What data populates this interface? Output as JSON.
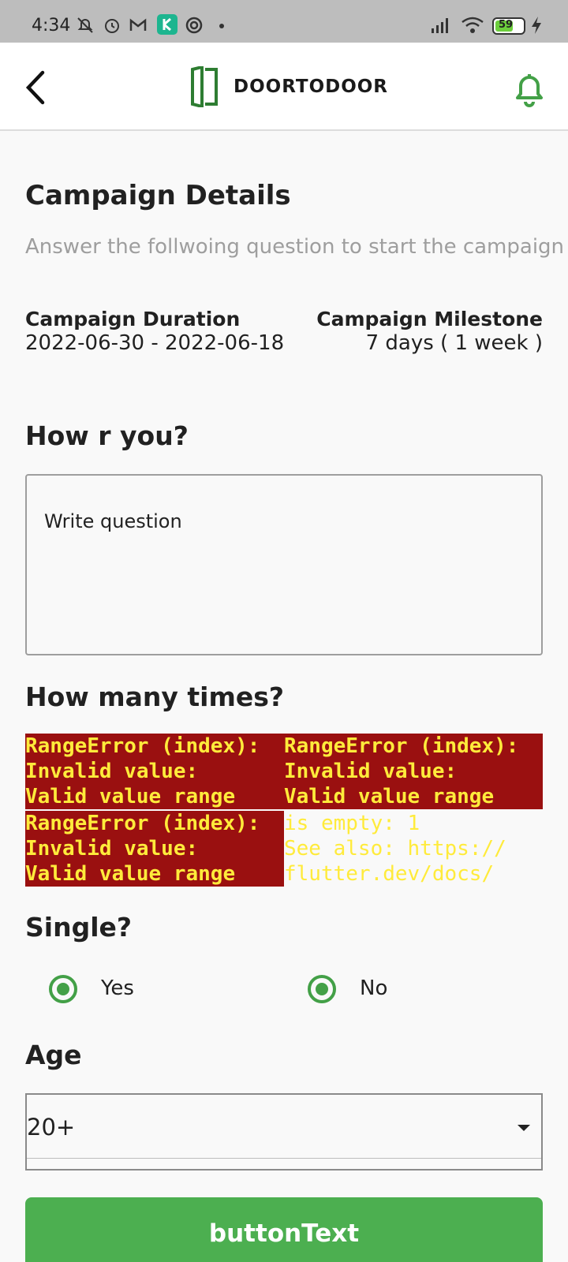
{
  "status_bar": {
    "time": "4:34",
    "battery": "59"
  },
  "app_bar": {
    "logo_text": "DOORTODOOR",
    "accent_color": "#43a047"
  },
  "page": {
    "title": "Campaign Details",
    "subtitle": "Answer the follwoing question to start the campaign"
  },
  "campaign": {
    "duration_label": "Campaign Duration",
    "duration_value": "2022-06-30 - 2022-06-18",
    "milestone_label": "Campaign Milestone",
    "milestone_value": "7 days ( 1 week )"
  },
  "questions": {
    "q1_label": "How r you?",
    "q1_placeholder": "Write question",
    "q2_label": "How many times?",
    "q3_label": "Single?",
    "q3_options": [
      "Yes",
      "No"
    ],
    "q4_label": "Age",
    "q4_value": "20+"
  },
  "errors": {
    "e1": "RangeError (index):\nInvalid value:\nValid value range",
    "e2": "RangeError (index):\nInvalid value:\nValid value range",
    "e3": "RangeError (index):\nInvalid value:\nValid value range",
    "e4": "is empty: 1\nSee also: https://\nflutter.dev/docs/"
  },
  "button": {
    "label": "buttonText"
  }
}
